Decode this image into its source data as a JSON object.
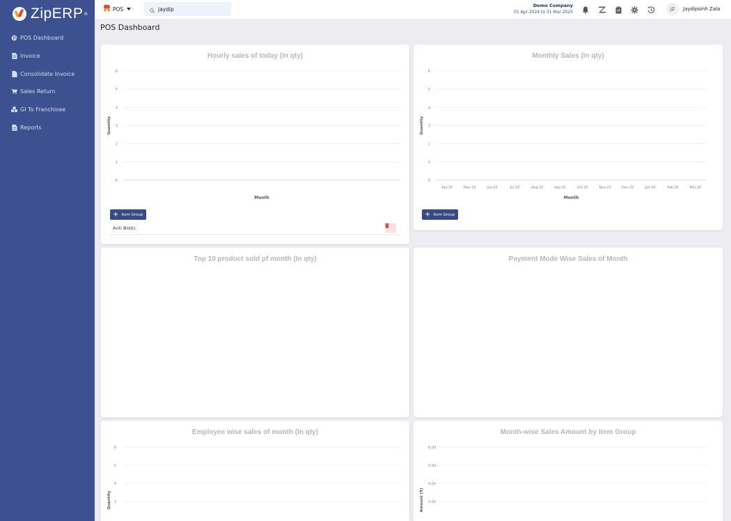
{
  "app": {
    "logo": "ZipERP",
    "logo_reg": "®"
  },
  "sidebar": {
    "items": [
      {
        "label": "POS Dashboard",
        "icon": "globe-icon"
      },
      {
        "label": "Invoice",
        "icon": "file-icon"
      },
      {
        "label": "Consolidate Invoice",
        "icon": "file-icon"
      },
      {
        "label": "Sales Return",
        "icon": "cart-icon"
      },
      {
        "label": "GI To Franchisee",
        "icon": "cubes-icon"
      },
      {
        "label": "Reports",
        "icon": "file-icon"
      }
    ]
  },
  "topbar": {
    "module": "POS",
    "search_value": "jaydip",
    "company_name": "Demo Company",
    "fiscal_year": "01 Apr 2024 to 31 Mar 2025",
    "user_initials": "JZ",
    "user_name": "Jaydipsinh Zala"
  },
  "page": {
    "title": "POS Dashboard"
  },
  "colors": {
    "sidebar": "#3d5190",
    "accent_button": "#3a4a80",
    "danger": "#e5403a"
  },
  "cards": {
    "hourly": {
      "title": "Hourly sales of today (In qty)",
      "add_label": "Item Group",
      "items": [
        "Anti Biotic"
      ]
    },
    "monthly": {
      "title": "Monthly Sales (In qty)",
      "add_label": "Item Group"
    },
    "top10": {
      "title": "Top 10 product sold pf month (In qty)"
    },
    "payment": {
      "title": "Payment Mode Wise Sales of Month"
    },
    "employee": {
      "title": "Employee wise sales of month (In qty)"
    },
    "itemgroup": {
      "title": "Month-wise Sales Amount by Item Group"
    }
  },
  "chart_data": [
    {
      "id": "hourly",
      "type": "line",
      "title": "Hourly sales of today (In qty)",
      "xlabel": "Month",
      "ylabel": "Quantity",
      "ylim": [
        0,
        6
      ],
      "yticks": [
        "0",
        "1",
        "2",
        "3",
        "4",
        "5",
        "6"
      ],
      "categories": [],
      "series": []
    },
    {
      "id": "monthly",
      "type": "line",
      "title": "Monthly Sales (In qty)",
      "xlabel": "Month",
      "ylabel": "Quantity",
      "ylim": [
        0,
        6
      ],
      "yticks": [
        "0",
        "1",
        "2",
        "3",
        "4",
        "5",
        "6"
      ],
      "categories": [
        "Apr-25",
        "May-25",
        "Jun-25",
        "Jul-25",
        "Aug-25",
        "Sep-25",
        "Oct-25",
        "Nov-25",
        "Dec-25",
        "Jan-26",
        "Feb-26",
        "Mar-26"
      ],
      "series": []
    },
    {
      "id": "employee",
      "type": "bar",
      "title": "Employee wise sales of month (In qty)",
      "xlabel": "",
      "ylabel": "Quantity",
      "yticks": [
        "3",
        "4",
        "5",
        "6"
      ],
      "categories": [],
      "series": []
    },
    {
      "id": "itemgroup",
      "type": "bar",
      "title": "Month-wise Sales Amount by Item Group",
      "xlabel": "",
      "ylabel": "Amount (₹)",
      "yticks": [
        "3.00",
        "4.00",
        "5.00",
        "6.00"
      ],
      "categories": [],
      "series": []
    }
  ]
}
